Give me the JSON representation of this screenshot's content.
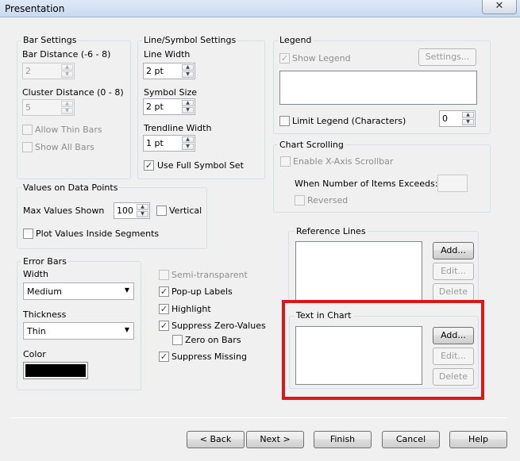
{
  "window": {
    "title": "Presentation",
    "close": "✕"
  },
  "bar_settings": {
    "title": "Bar Settings",
    "bar_distance_label": "Bar Distance (-6 - 8)",
    "bar_distance_value": "2",
    "cluster_distance_label": "Cluster Distance (0 - 8)",
    "cluster_distance_value": "5",
    "allow_thin_bars": "Allow Thin Bars",
    "show_all_bars": "Show All Bars"
  },
  "line_symbol": {
    "title": "Line/Symbol Settings",
    "line_width_label": "Line Width",
    "line_width_value": "2 pt",
    "symbol_size_label": "Symbol Size",
    "symbol_size_value": "2 pt",
    "trendline_width_label": "Trendline Width",
    "trendline_width_value": "1 pt",
    "use_full_symbol_set": "Use Full Symbol Set"
  },
  "legend": {
    "title": "Legend",
    "show_legend": "Show Legend",
    "settings_button": "Settings...",
    "limit_legend": "Limit Legend (Characters)",
    "limit_value": "0"
  },
  "chart_scrolling": {
    "title": "Chart Scrolling",
    "enable_scrollbar": "Enable X-Axis Scrollbar",
    "when_exceeds": "When Number of Items Exceeds:",
    "reversed": "Reversed"
  },
  "values_on_points": {
    "title": "Values on Data Points",
    "max_values_label": "Max Values Shown",
    "max_values_value": "100",
    "vertical": "Vertical",
    "plot_inside": "Plot Values Inside Segments"
  },
  "error_bars": {
    "title": "Error Bars",
    "width_label": "Width",
    "width_value": "Medium",
    "thickness_label": "Thickness",
    "thickness_value": "Thin",
    "color_label": "Color",
    "color_swatch": "#000000"
  },
  "options": {
    "semi_transparent": "Semi-transparent",
    "popup_labels": "Pop-up Labels",
    "highlight": "Highlight",
    "suppress_zero": "Suppress Zero-Values",
    "zero_on_bars": "Zero on Bars",
    "suppress_missing": "Suppress Missing"
  },
  "reference_lines": {
    "title": "Reference Lines",
    "add": "Add...",
    "edit": "Edit...",
    "delete": "Delete"
  },
  "text_in_chart": {
    "title": "Text in Chart",
    "add": "Add...",
    "edit": "Edit...",
    "delete": "Delete",
    "highlight_color": "#d9181e"
  },
  "footer": {
    "back": "< Back",
    "next": "Next >",
    "finish": "Finish",
    "cancel": "Cancel",
    "help": "Help"
  },
  "glyphs": {
    "check": "✓",
    "up": "▲",
    "down": "▼"
  }
}
